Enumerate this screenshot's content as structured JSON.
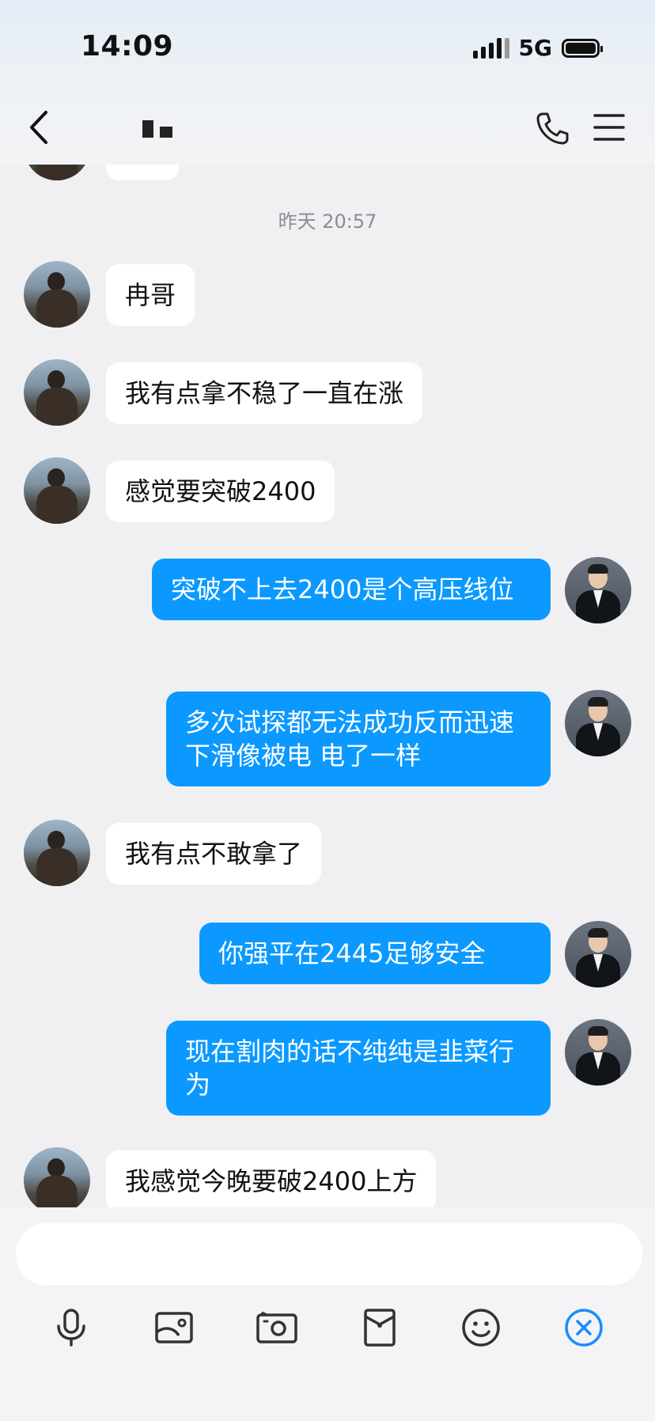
{
  "status_bar": {
    "time": "14:09",
    "network": "5G"
  },
  "header": {
    "back_icon": "chevron-left-icon",
    "call_icon": "phone-icon",
    "menu_icon": "menu-icon"
  },
  "chat": {
    "timestamp": "昨天 20:57",
    "messages": [
      {
        "side": "in",
        "text": "冉哥"
      },
      {
        "side": "in",
        "text": "我有点拿不稳了一直在涨"
      },
      {
        "side": "in",
        "text": "感觉要突破2400"
      },
      {
        "side": "out",
        "text": "突破不上去2400是个高压线位"
      },
      {
        "side": "out",
        "text": "多次试探都无法成功反而迅速下滑像被电 电了一样"
      },
      {
        "side": "in",
        "text": "我有点不敢拿了"
      },
      {
        "side": "out",
        "text": "你强平在2445足够安全"
      },
      {
        "side": "out",
        "text": "现在割肉的话不纯纯是韭菜行为"
      },
      {
        "side": "in",
        "text": "我感觉今晚要破2400上方"
      }
    ]
  },
  "input_bar": {
    "placeholder": "",
    "tools": [
      "microphone-icon",
      "image-icon",
      "camera-icon",
      "red-packet-icon",
      "emoji-icon",
      "close-icon"
    ],
    "accent": "#1a8cff"
  },
  "colors": {
    "bubble_out": "#0b99ff",
    "bubble_in": "#ffffff",
    "background": "#f0f0f2"
  }
}
